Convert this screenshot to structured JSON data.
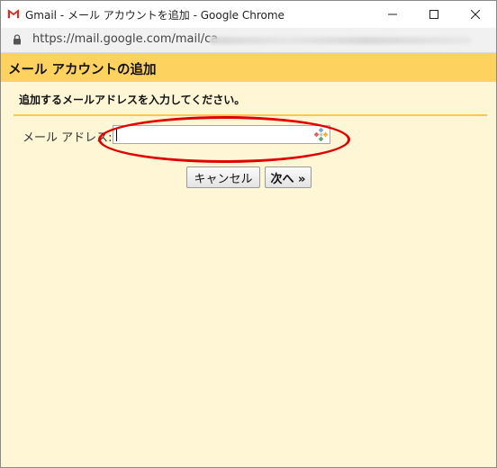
{
  "window": {
    "title": "Gmail - メール アカウントを追加 - Google Chrome",
    "controls": [
      "minimize-icon",
      "maximize-icon",
      "close-icon"
    ]
  },
  "address_bar": {
    "url": "https://mail.google.com/mail/ca",
    "url_obscured": true
  },
  "dialog": {
    "title": "メール アカウントの追加",
    "instruction": "追加するメールアドレスを入力してください。",
    "email_label": "メール アドレス:",
    "email_value": "",
    "cancel_label": "キャンセル",
    "next_label": "次へ »"
  },
  "colors": {
    "header_bg": "#fdd25f",
    "dialog_bg": "#fff6d6",
    "separator": "#f7c94a",
    "annotation": "#e00000"
  }
}
